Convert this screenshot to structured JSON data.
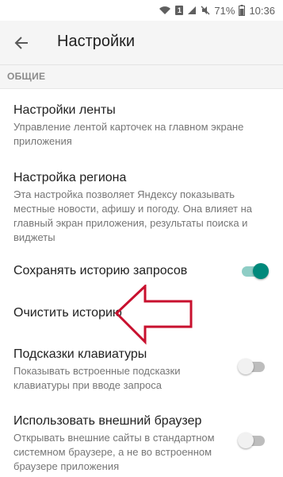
{
  "status_bar": {
    "sim": "1",
    "battery": "71%",
    "time": "10:36"
  },
  "appbar": {
    "title": "Настройки"
  },
  "section": {
    "header": "ОБЩИЕ"
  },
  "settings": [
    {
      "title": "Настройки ленты",
      "description": "Управление лентой карточек на главном экране приложения"
    },
    {
      "title": "Настройка региона",
      "description": "Эта настройка позволяет Яндексу показывать местные новости, афишу и погоду. Она влияет на главный экран приложения, результаты поиска и виджеты"
    },
    {
      "title": "Сохранять историю запросов",
      "description": "",
      "toggle": true
    },
    {
      "title": "Очистить историю",
      "description": ""
    },
    {
      "title": "Подсказки клавиатуры",
      "description": "Показывать встроенные подсказки клавиатуры при вводе запроса",
      "toggle": false
    },
    {
      "title": "Использовать внешний браузер",
      "description": "Открывать внешние сайты в стандартном системном браузере, а не во встроенном браузере приложения",
      "toggle": false
    }
  ],
  "colors": {
    "accent": "#00897b",
    "annotation_arrow": "#c8102e"
  }
}
